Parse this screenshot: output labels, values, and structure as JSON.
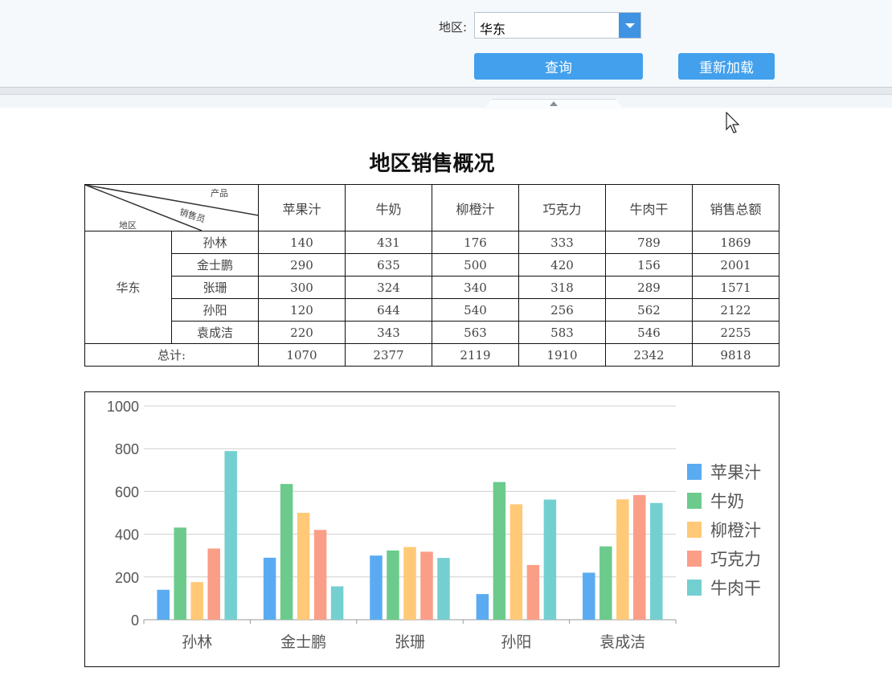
{
  "params": {
    "region_label": "地区:",
    "region_value": "华东",
    "query_label": "查询",
    "reload_label": "重新加载"
  },
  "report": {
    "title": "地区销售概况",
    "diag_top": "产品",
    "diag_mid": "销售员",
    "diag_bottom": "地区",
    "columns": [
      "苹果汁",
      "牛奶",
      "柳橙汁",
      "巧克力",
      "牛肉干",
      "销售总额"
    ],
    "region": "华东",
    "rows": [
      {
        "name": "孙林",
        "values": [
          "140",
          "431",
          "176",
          "333",
          "789",
          "1869"
        ]
      },
      {
        "name": "金士鹏",
        "values": [
          "290",
          "635",
          "500",
          "420",
          "156",
          "2001"
        ]
      },
      {
        "name": "张珊",
        "values": [
          "300",
          "324",
          "340",
          "318",
          "289",
          "1571"
        ]
      },
      {
        "name": "孙阳",
        "values": [
          "120",
          "644",
          "540",
          "256",
          "562",
          "2122"
        ]
      },
      {
        "name": "袁成洁",
        "values": [
          "220",
          "343",
          "563",
          "583",
          "546",
          "2255"
        ]
      }
    ],
    "total_label": "总计:",
    "totals": [
      "1070",
      "2377",
      "2119",
      "1910",
      "2342",
      "9818"
    ]
  },
  "chart_data": {
    "type": "bar",
    "categories": [
      "孙林",
      "金士鹏",
      "张珊",
      "孙阳",
      "袁成洁"
    ],
    "series": [
      {
        "name": "苹果汁",
        "color": "#5aabf1",
        "values": [
          140,
          290,
          300,
          120,
          220
        ]
      },
      {
        "name": "牛奶",
        "color": "#6ccb8c",
        "values": [
          431,
          635,
          324,
          644,
          343
        ]
      },
      {
        "name": "柳橙汁",
        "color": "#ffc977",
        "values": [
          176,
          500,
          340,
          540,
          563
        ]
      },
      {
        "name": "巧克力",
        "color": "#fb9e87",
        "values": [
          333,
          420,
          318,
          256,
          583
        ]
      },
      {
        "name": "牛肉干",
        "color": "#74cfd0",
        "values": [
          789,
          156,
          289,
          562,
          546
        ]
      }
    ],
    "ylim": [
      0,
      1000
    ],
    "yticks": [
      "0",
      "200",
      "400",
      "600",
      "800",
      "1000"
    ],
    "grid": true,
    "legend": "right"
  }
}
